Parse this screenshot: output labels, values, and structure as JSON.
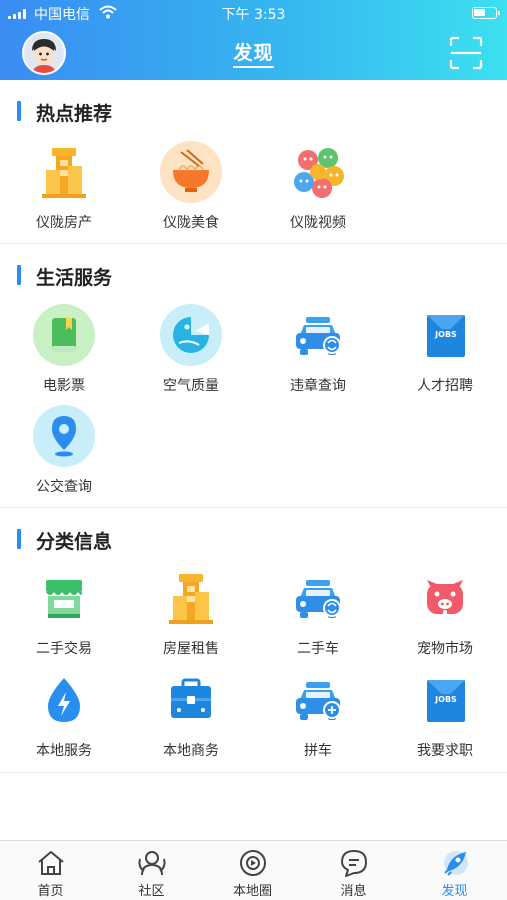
{
  "status_bar": {
    "carrier": "中国电信",
    "time": "下午 3:53"
  },
  "header": {
    "title": "发现"
  },
  "sections": [
    {
      "title": "热点推荐",
      "items": [
        {
          "label": "仪陇房产",
          "icon": "building-icon"
        },
        {
          "label": "仪陇美食",
          "icon": "noodle-bowl-icon"
        },
        {
          "label": "仪陇视频",
          "icon": "faces-icon"
        }
      ]
    },
    {
      "title": "生活服务",
      "items": [
        {
          "label": "电影票",
          "icon": "book-icon"
        },
        {
          "label": "空气质量",
          "icon": "air-quality-icon"
        },
        {
          "label": "违章查询",
          "icon": "car-icon"
        },
        {
          "label": "人才招聘",
          "icon": "jobs-icon"
        },
        {
          "label": "公交查询",
          "icon": "location-pin-icon"
        }
      ]
    },
    {
      "title": "分类信息",
      "items": [
        {
          "label": "二手交易",
          "icon": "market-stall-icon"
        },
        {
          "label": "房屋租售",
          "icon": "building-icon"
        },
        {
          "label": "二手车",
          "icon": "car-icon"
        },
        {
          "label": "宠物市场",
          "icon": "pig-icon"
        },
        {
          "label": "本地服务",
          "icon": "drop-icon"
        },
        {
          "label": "本地商务",
          "icon": "briefcase-icon"
        },
        {
          "label": "拼车",
          "icon": "carpool-icon"
        },
        {
          "label": "我要求职",
          "icon": "jobs-icon"
        }
      ]
    }
  ],
  "tabs": [
    {
      "label": "首页",
      "icon": "home-icon"
    },
    {
      "label": "社区",
      "icon": "community-icon"
    },
    {
      "label": "本地圈",
      "icon": "local-circle-icon"
    },
    {
      "label": "消息",
      "icon": "message-icon"
    },
    {
      "label": "发现",
      "icon": "rocket-icon",
      "active": true
    }
  ],
  "colors": {
    "accent": "#2a8ef0",
    "header_start": "#3a8cf2",
    "header_end": "#3de0f0"
  }
}
